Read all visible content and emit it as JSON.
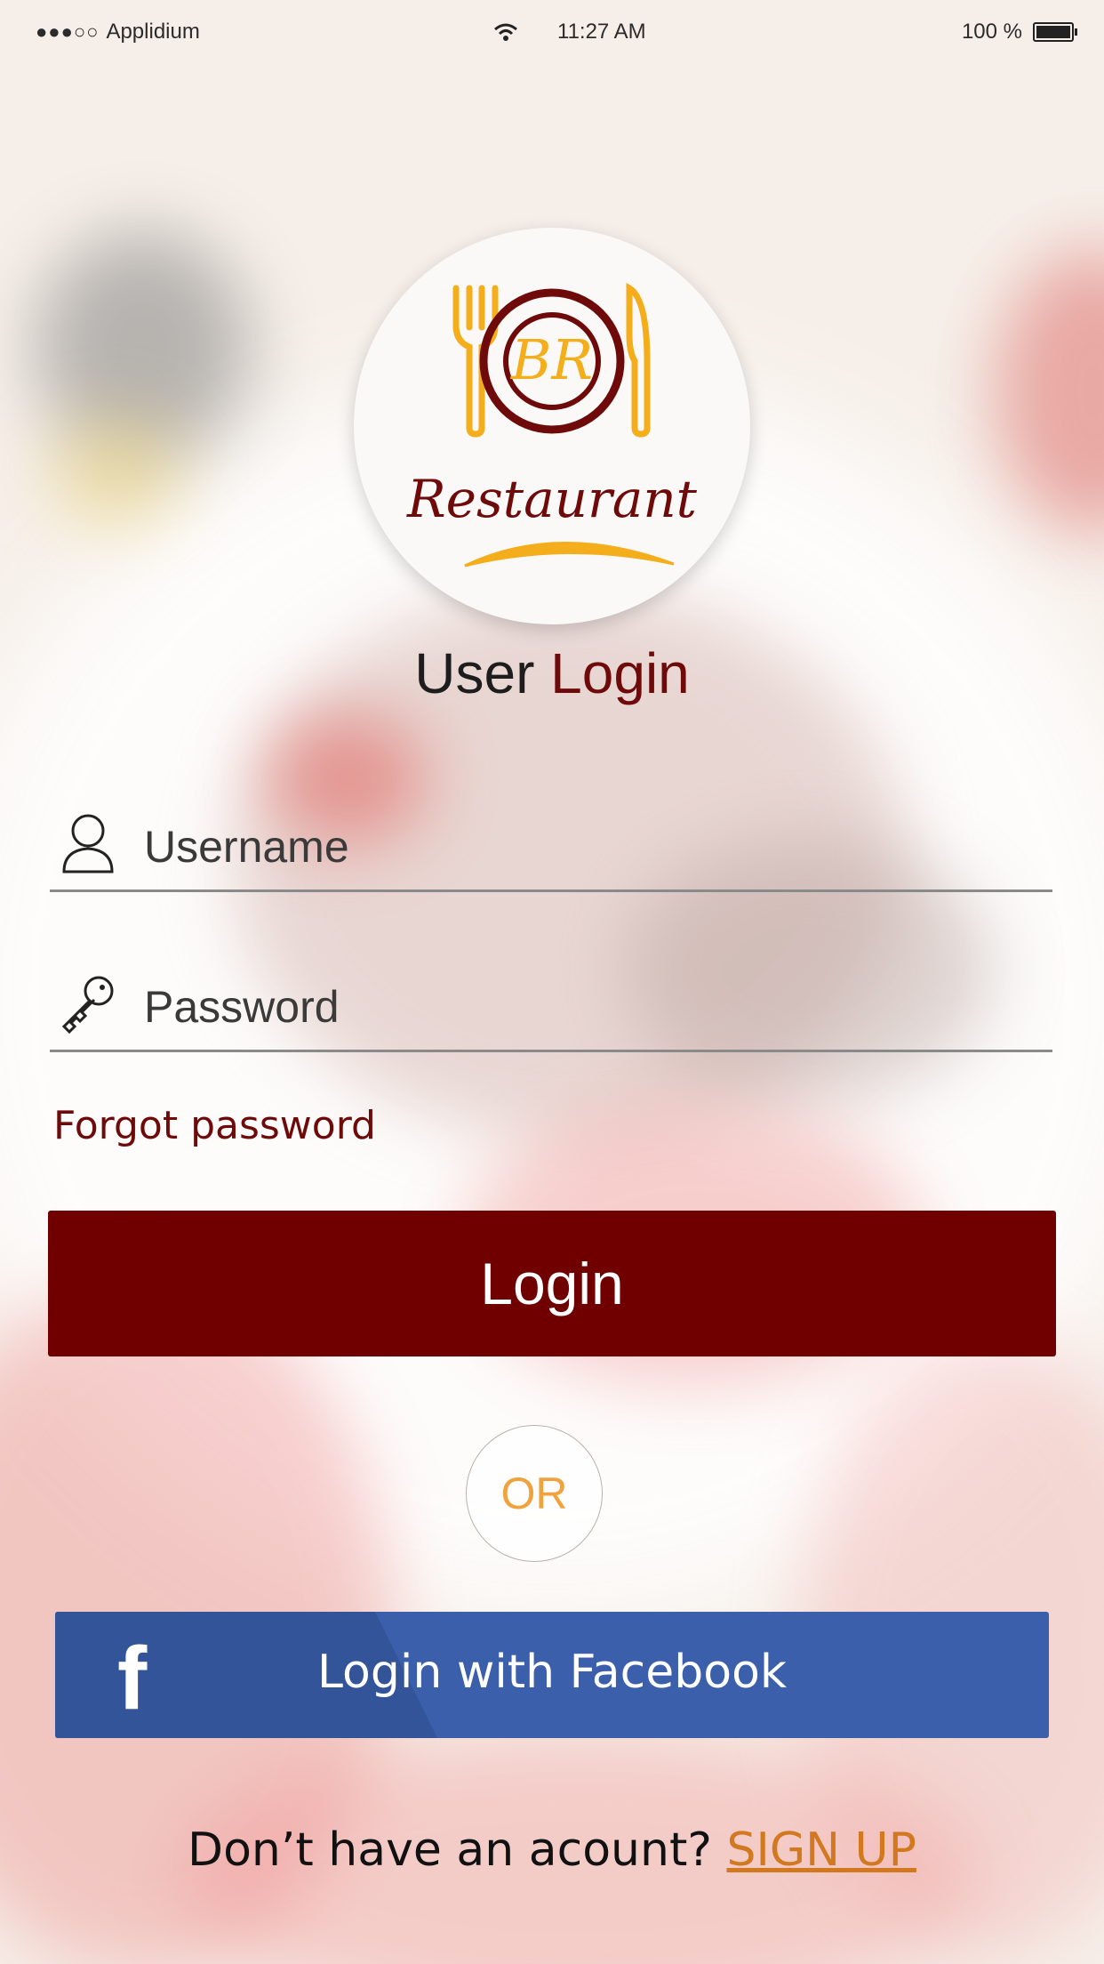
{
  "status_bar": {
    "signal": "●●●○○",
    "carrier": "Applidium",
    "time": "11:27 AM",
    "battery": "100 %"
  },
  "logo": {
    "monogram": "BR",
    "wordmark": "Restaurant"
  },
  "title": {
    "prefix": "User",
    "accent": "Login"
  },
  "form": {
    "username_placeholder": "Username",
    "password_placeholder": "Password",
    "forgot_label": "Forgot password",
    "login_label": "Login"
  },
  "divider_text": "OR",
  "facebook": {
    "icon": "f",
    "label": "Login with Facebook"
  },
  "signup": {
    "prompt": "Don’t have an acount?",
    "link": "SIGN UP"
  },
  "colors": {
    "brand": "#700000",
    "accent_orange": "#f0a23d",
    "facebook": "#3b5faa",
    "signup_link": "#d2781f"
  }
}
